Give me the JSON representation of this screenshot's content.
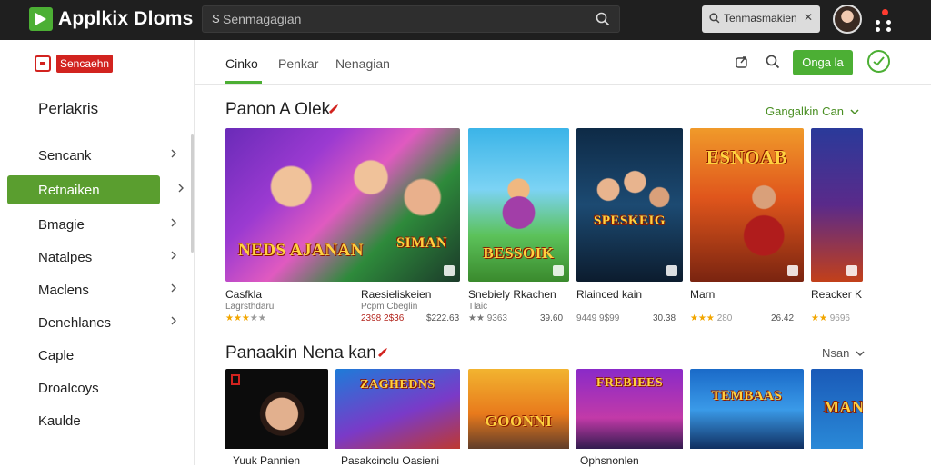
{
  "app": {
    "title": "Applkix Dloms"
  },
  "search": {
    "prefix": "S",
    "placeholder": "Senmagagian"
  },
  "user_search": {
    "text": "Tenmasmakien",
    "close": "✕"
  },
  "sidebar": {
    "badge": "Sencaehn",
    "heading": "Perlakris",
    "items": [
      {
        "label": "Sencank"
      },
      {
        "label": "Retnaiken",
        "active": true
      },
      {
        "label": "Bmagie"
      },
      {
        "label": "Natalpes"
      },
      {
        "label": "Maclens"
      },
      {
        "label": "Denehlanes"
      },
      {
        "label": "Caple"
      },
      {
        "label": "Droalcoys"
      },
      {
        "label": "Kaulde"
      }
    ]
  },
  "tabs": [
    {
      "label": "Cinko",
      "active": true
    },
    {
      "label": "Penkar"
    },
    {
      "label": "Nenagian"
    }
  ],
  "toolbar": {
    "open_label": "Onga la"
  },
  "section1": {
    "title": "Panon A Olek",
    "see_more": "Gangalkin Can",
    "cards": [
      {
        "name": "Casfkla",
        "meta": "Lagrsthdaru",
        "stars": "★★★",
        "stars_gray": "★★",
        "count": "",
        "art_text": "NEDS AJANAN"
      },
      {
        "name": "",
        "meta": "",
        "stars": "",
        "stars_gray": "",
        "count": "",
        "art_text": "SIMAN"
      },
      {
        "name": "Raesieliskeien",
        "meta": "Pcpm Cbeglin",
        "stars": "",
        "stars_gray": "",
        "count": "$222.63",
        "extra": "2398 2$36",
        "art_text": ""
      },
      {
        "name": "Snebiely Rkachen",
        "meta": "Tlaic",
        "stars": "★★★",
        "stars_gray": "★",
        "count": "39.60",
        "extra": "★★ 9363",
        "art_text": "BESSOIK"
      },
      {
        "name": "Rlainced kain",
        "meta": "",
        "stars": "",
        "stars_gray": "",
        "count": "30.38",
        "extra": "9449 9$99",
        "art_text": "SPESKEIG"
      },
      {
        "name": "Marn",
        "meta": "",
        "stars": "★★★",
        "stars_gray": "",
        "count": "26.42",
        "extra": "280",
        "art_text": "ESNOAB"
      },
      {
        "name": "Reacker K",
        "meta": "",
        "stars": "★★",
        "stars_gray": "",
        "count": "",
        "extra": "9696",
        "art_text": ""
      }
    ]
  },
  "section2": {
    "title": "Panaakin Nena kan",
    "see_more": "Nsan",
    "cards": [
      {
        "art_text": ""
      },
      {
        "art_text": "ZAGHEDNS"
      },
      {
        "art_text": "GOONNI"
      },
      {
        "art_text": "FREBIEES"
      },
      {
        "art_text": "TEMBAAS"
      },
      {
        "art_text": "MAN"
      }
    ],
    "bottom_names": [
      "Yuuk Pannien",
      "Pasakcinclu Oasieni",
      "Ophsnonlen"
    ]
  },
  "colors": {
    "brand_green": "#4caf34",
    "active_item": "#5a9e2f",
    "topbar": "#1f1f1f",
    "accent_red": "#d2231f"
  }
}
